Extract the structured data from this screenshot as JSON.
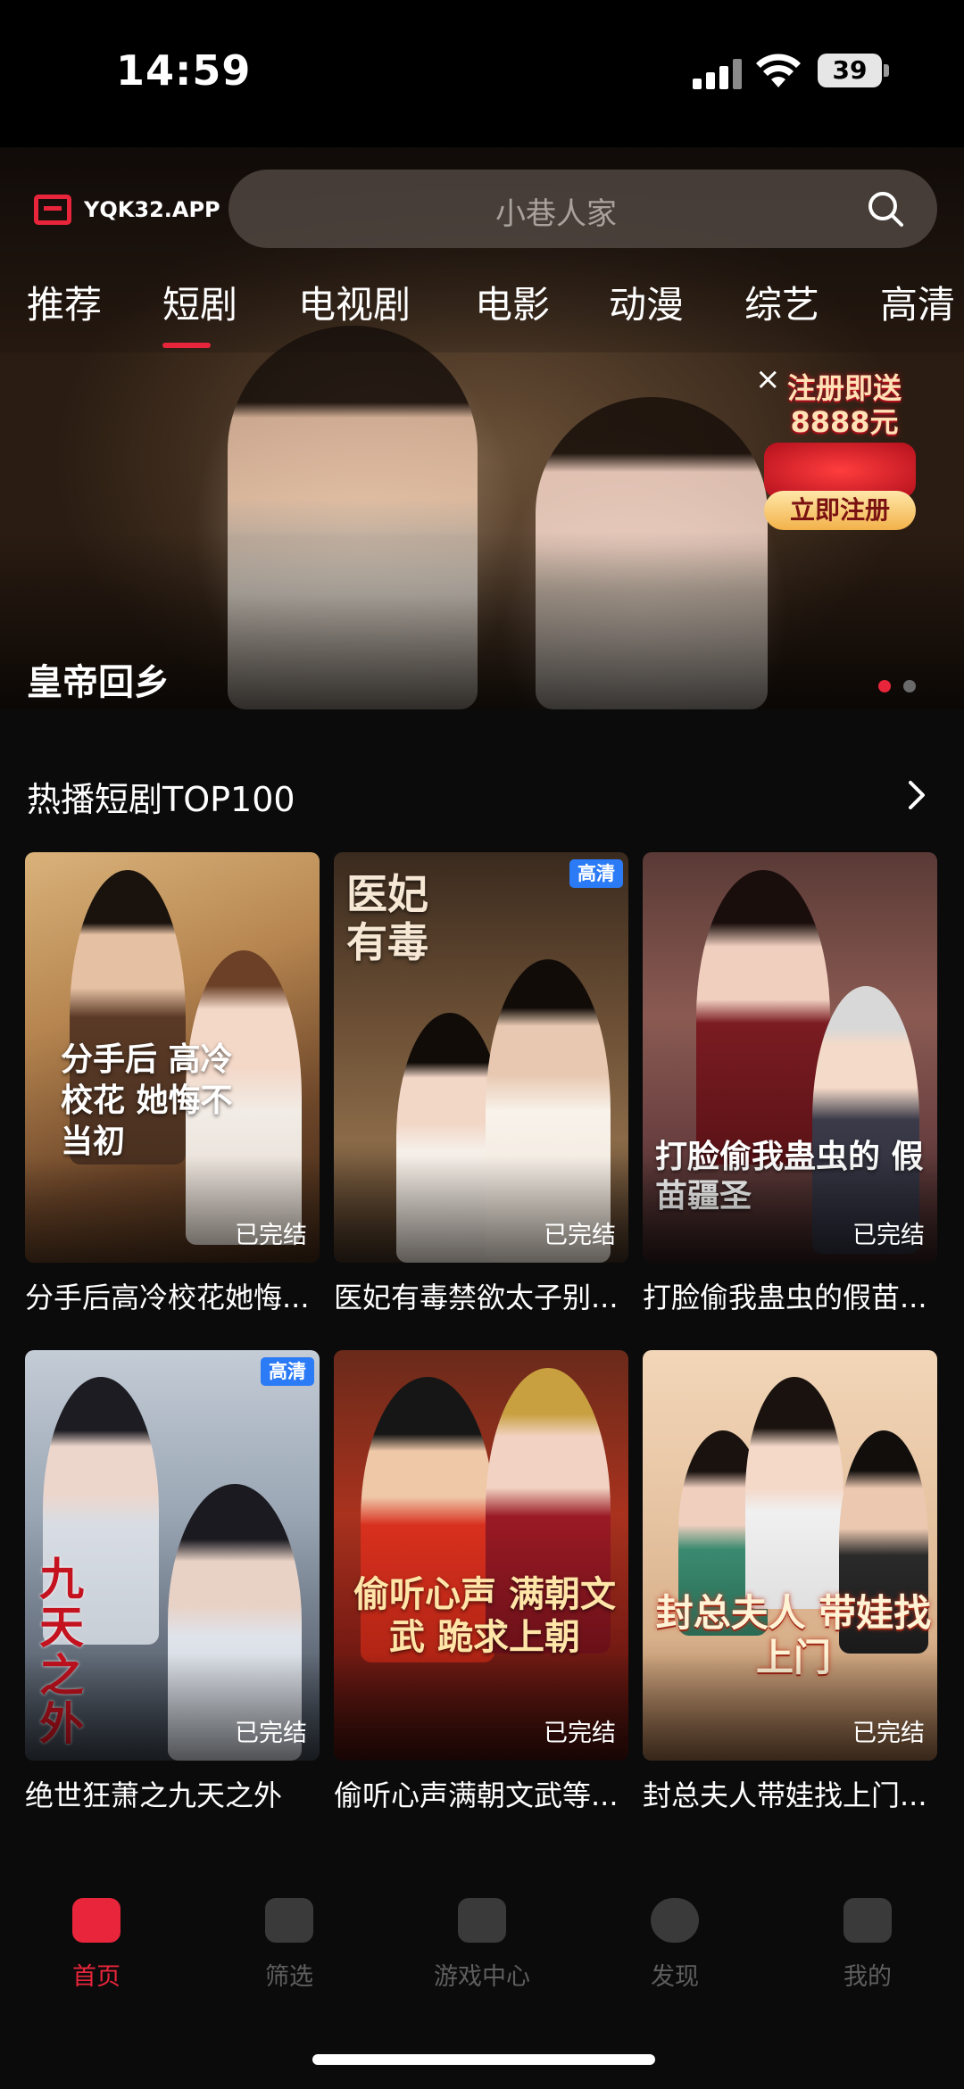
{
  "status_bar": {
    "time": "14:59",
    "battery": "39"
  },
  "header": {
    "logo_text": "YQK32.APP",
    "search_placeholder": "小巷人家"
  },
  "tabs": [
    {
      "label": "推荐"
    },
    {
      "label": "短剧",
      "active": true
    },
    {
      "label": "电视剧"
    },
    {
      "label": "电影"
    },
    {
      "label": "动漫"
    },
    {
      "label": "综艺"
    },
    {
      "label": "高清"
    }
  ],
  "banner": {
    "title": "皇帝回乡",
    "promo": {
      "title_line1": "注册即送",
      "title_line2": "8888元",
      "button": "立即注册",
      "close": "×"
    },
    "dots": 2,
    "active_dot": 0
  },
  "section": {
    "title": "热播短剧TOP100"
  },
  "cards": [
    {
      "title": "分手后高冷校花她悔...",
      "status": "已完结",
      "hd": "",
      "caption": "分手后 高冷校花 她悔不当初"
    },
    {
      "title": "医妃有毒禁欲太子别...",
      "status": "已完结",
      "hd": "高清",
      "caption": "医妃 有毒"
    },
    {
      "title": "打脸偷我蛊虫的假苗...",
      "status": "已完结",
      "hd": "",
      "caption": "打脸偷我蛊虫的 假苗疆圣"
    },
    {
      "title": "绝世狂萧之九天之外",
      "status": "已完结",
      "hd": "高清",
      "caption": "九天之外"
    },
    {
      "title": "偷听心声满朝文武等...",
      "status": "已完结",
      "hd": "",
      "caption": "偷听心声 满朝文武 跪求上朝"
    },
    {
      "title": "封总夫人带娃找上门...",
      "status": "已完结",
      "hd": "",
      "caption": "封总夫人 带娃找上门"
    }
  ],
  "bottom_nav": [
    {
      "label": "首页",
      "icon": "clapperboard-icon",
      "active": true
    },
    {
      "label": "筛选",
      "icon": "filter-icon"
    },
    {
      "label": "游戏中心",
      "icon": "game-icon"
    },
    {
      "label": "发现",
      "icon": "discover-icon"
    },
    {
      "label": "我的",
      "icon": "profile-icon"
    }
  ],
  "colors": {
    "accent": "#e8253b",
    "hd_badge": "#2b7bf6",
    "background": "#0b0b0b"
  }
}
